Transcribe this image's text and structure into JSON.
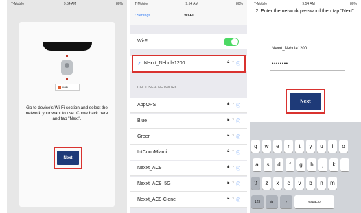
{
  "panel1": {
    "status_left": "T-Mobile",
    "status_time": "9:54 AM",
    "status_right": "80%",
    "wifi_card_label": "WiFi",
    "instructions": "Go to device's Wi-Fi section and select the network your want to use. Come back here and tap \"Next\".",
    "next_label": "Next"
  },
  "panel2": {
    "status_left": "T-Mobile",
    "status_time": "9:54 AM",
    "status_right": "80%",
    "back_label": "Settings",
    "title": "Wi-Fi",
    "wifi_row_label": "Wi-Fi",
    "connected_network": "Nexxt_Nebula1200",
    "section_header": "CHOOSE A NETWORK...",
    "networks": [
      "AppOPS",
      "Blue",
      "Green",
      "IntCoopMiami",
      "Nexxt_AC9",
      "Nexxt_AC9_5G",
      "Nexxt_AC9-Clone"
    ]
  },
  "panel3": {
    "status_left": "T-Mobile",
    "status_time": "9:54 AM",
    "status_right": "80%",
    "heading": "2. Enter the network password then tap \"Next\".",
    "network_name": "Nexxt_Nebula1200",
    "password_mask": "••••••••",
    "next_label": "Next",
    "keyboard_row1": [
      "q",
      "w",
      "e",
      "r",
      "t",
      "y",
      "u",
      "i",
      "o"
    ],
    "keyboard_row2": [
      "a",
      "s",
      "d",
      "f",
      "g",
      "h",
      "j",
      "k",
      "l"
    ],
    "keyboard_row3": [
      "z",
      "x",
      "c",
      "v",
      "b",
      "n",
      "m"
    ],
    "shift_label": "⇧",
    "key_123": "123",
    "space_label": "espacio"
  },
  "colors": {
    "button_blue": "#1e3a78",
    "highlight_red": "#d9322f",
    "ios_blue": "#2f7af5",
    "toggle_green": "#4cd964"
  }
}
